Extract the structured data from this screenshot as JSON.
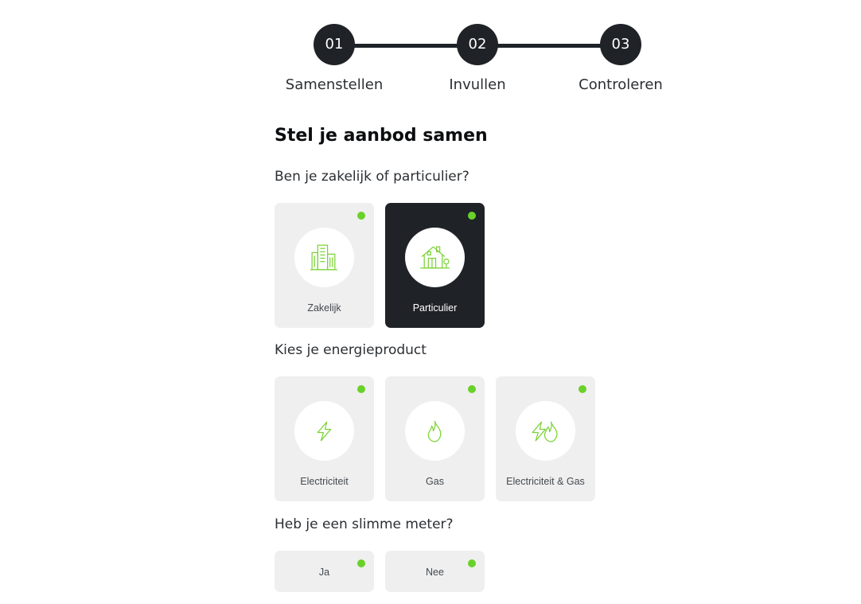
{
  "stepper": {
    "steps": [
      {
        "number": "01",
        "label": "Samenstellen"
      },
      {
        "number": "02",
        "label": "Invullen"
      },
      {
        "number": "03",
        "label": "Controleren"
      }
    ]
  },
  "main": {
    "title": "Stel je aanbod samen",
    "customer_type": {
      "question": "Ben je zakelijk of particulier?",
      "selected": "Particulier",
      "options": [
        {
          "label": "Zakelijk",
          "icon": "office-building-icon"
        },
        {
          "label": "Particulier",
          "icon": "house-icon"
        }
      ]
    },
    "energy_product": {
      "question": "Kies je energieproduct",
      "options": [
        {
          "label": "Electriciteit",
          "icon": "lightning-icon"
        },
        {
          "label": "Gas",
          "icon": "flame-icon"
        },
        {
          "label": "Electriciteit & Gas",
          "icon": "lightning-flame-icon"
        }
      ]
    },
    "smart_meter": {
      "question": "Heb je een slimme meter?",
      "options": [
        {
          "label": "Ja"
        },
        {
          "label": "Nee"
        }
      ]
    }
  },
  "colors": {
    "dark": "#1f2328",
    "card_background": "#efefef",
    "accent_green": "#6ad12a",
    "icon_green": "#7bd335"
  }
}
